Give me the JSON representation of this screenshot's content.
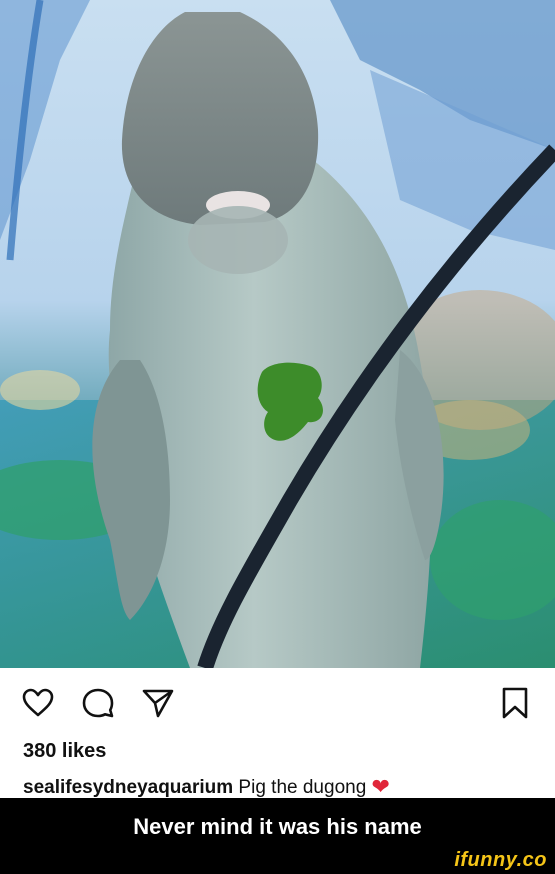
{
  "post": {
    "image_alt_icon": "dugong-photo",
    "likes": "380 likes",
    "username": "sealifesydneyaquarium",
    "caption": " Pig the dugong ",
    "heart_emoji": "❤"
  },
  "actions": {
    "like_icon": "heart-icon",
    "comment_icon": "comment-icon",
    "share_icon": "send-icon",
    "save_icon": "bookmark-icon"
  },
  "meme": {
    "text": "Never mind it was his name",
    "watermark": "ifunny.co"
  },
  "colors": {
    "accent_heart": "#e0263a",
    "watermark": "#f5c518",
    "meme_bar": "#000000"
  }
}
